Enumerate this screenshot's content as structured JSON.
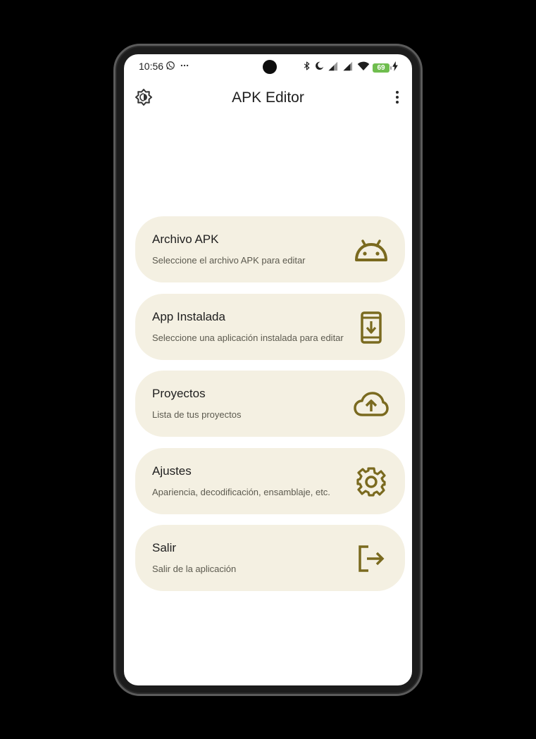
{
  "status_bar": {
    "time": "10:56",
    "battery_level": "69",
    "icons": [
      "whatsapp-icon",
      "more-notifications-icon",
      "bluetooth-icon",
      "do-not-disturb-icon",
      "signal-icon",
      "signal-icon",
      "wifi-icon",
      "battery-icon",
      "charging-icon"
    ]
  },
  "app_bar": {
    "title": "APK Editor",
    "left_icon": "brightness-icon",
    "right_icon": "more-vert-icon"
  },
  "menu": {
    "items": [
      {
        "title": "Archivo APK",
        "subtitle": "Seleccione el archivo APK para editar",
        "icon": "android-icon"
      },
      {
        "title": "App Instalada",
        "subtitle": "Seleccione una aplicación instalada para editar",
        "icon": "install-mobile-icon"
      },
      {
        "title": "Proyectos",
        "subtitle": "Lista de tus proyectos",
        "icon": "cloud-upload-icon"
      },
      {
        "title": "Ajustes",
        "subtitle": "Apariencia, decodificación, ensamblaje, etc.",
        "icon": "gear-icon"
      },
      {
        "title": "Salir",
        "subtitle": "Salir de la aplicación",
        "icon": "logout-icon"
      }
    ]
  },
  "colors": {
    "card_background": "#f4f0e2",
    "icon_accent": "#7a6a1f",
    "screen_background": "#ffffff",
    "battery": "#6fbd4e"
  }
}
